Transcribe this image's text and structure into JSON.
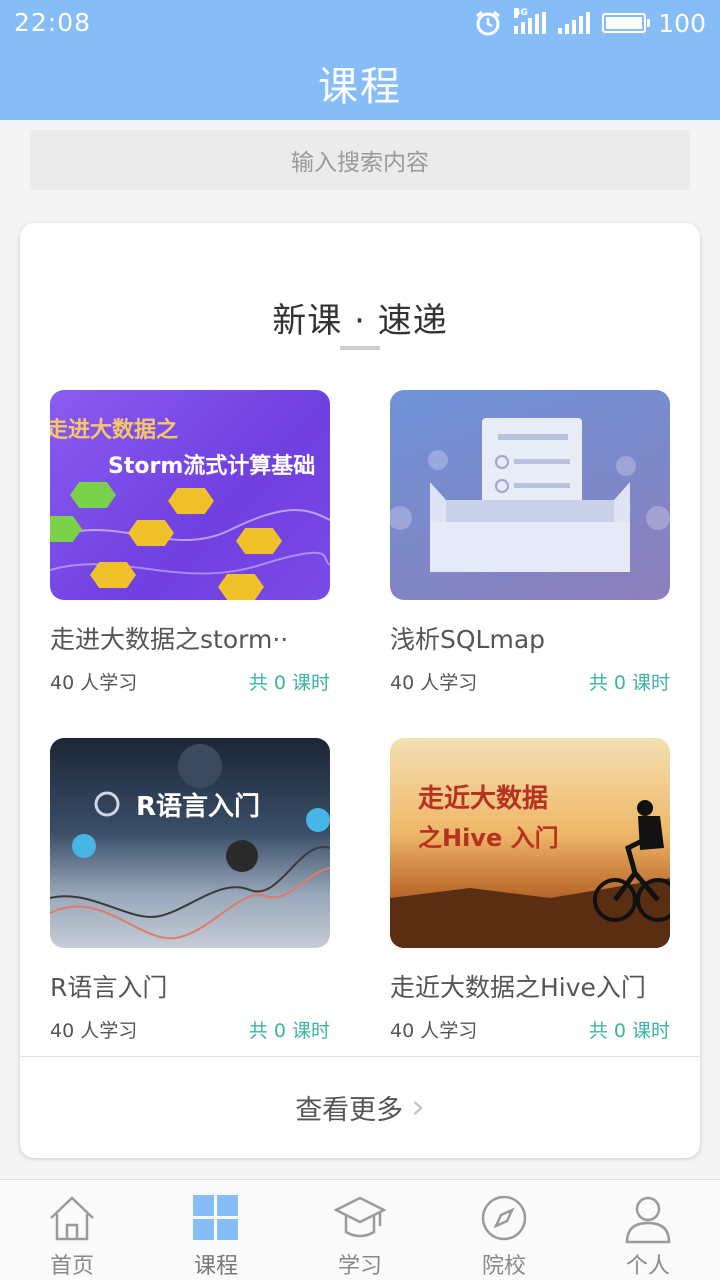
{
  "status_bar": {
    "time": "22:08",
    "battery": "100",
    "network": "4G"
  },
  "header": {
    "title": "课程"
  },
  "search": {
    "placeholder": "输入搜索内容"
  },
  "section": {
    "title": "新课 · 速递"
  },
  "courses": [
    {
      "name": "走进大数据之storm··",
      "learners": "40 人学习",
      "lessons": "共 0 课时",
      "thumb_title_1": "走进大数据之",
      "thumb_title_2": "Storm流式计算基础"
    },
    {
      "name": "浅析SQLmap",
      "learners": "40 人学习",
      "lessons": "共 0 课时"
    },
    {
      "name": "R语言入门",
      "learners": "40 人学习",
      "lessons": "共 0 课时",
      "thumb_title": "R语言入门"
    },
    {
      "name": "走近大数据之Hive入门",
      "learners": "40 人学习",
      "lessons": "共 0 课时",
      "thumb_title_1": "走近大数据",
      "thumb_title_2": "之Hive 入门"
    }
  ],
  "more": {
    "label": "查看更多"
  },
  "tabs": [
    {
      "label": "首页",
      "icon": "home-icon"
    },
    {
      "label": "课程",
      "icon": "grid-icon"
    },
    {
      "label": "学习",
      "icon": "mortarboard-icon"
    },
    {
      "label": "院校",
      "icon": "compass-icon"
    },
    {
      "label": "个人",
      "icon": "person-icon"
    }
  ],
  "colors": {
    "header": "#86bdf7",
    "accent": "#3cb4a2",
    "active_tab": "#86bdf7"
  }
}
